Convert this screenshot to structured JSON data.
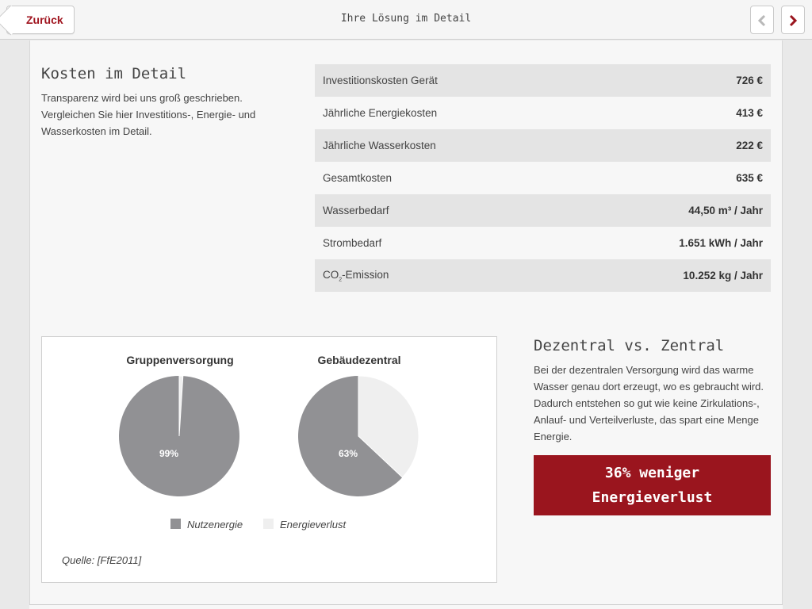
{
  "header": {
    "back_label": "Zurück",
    "title": "Ihre Lösung im Detail"
  },
  "kosten": {
    "title": "Kosten im Detail",
    "text": "Transparenz wird bei uns groß geschrieben. Vergleichen Sie hier Investitions-, Energie- und Wasserkosten im Detail."
  },
  "cost_table": [
    {
      "label": "Investitionskosten Gerät",
      "value": "726 €"
    },
    {
      "label": "Jährliche Energiekosten",
      "value": "413 €"
    },
    {
      "label": "Jährliche Wasserkosten",
      "value": "222 €"
    },
    {
      "label": "Gesamtkosten",
      "value": "635 €"
    },
    {
      "label": "Wasserbedarf",
      "value": "44,50 m³ / Jahr"
    },
    {
      "label": "Strombedarf",
      "value": "1.651 kWh / Jahr"
    },
    {
      "label_prefix": "CO",
      "label_sub": "2",
      "label_suffix": "-Emission",
      "value": "10.252 kg / Jahr"
    }
  ],
  "colors": {
    "accent": "#9a151e",
    "nutzenergie": "#919194",
    "energieverlust": "#efefef"
  },
  "chart_data": {
    "type": "pie",
    "charts": [
      {
        "title": "Gruppenversorgung",
        "label": "99%",
        "slices": [
          {
            "name": "Nutzenergie",
            "value": 99
          },
          {
            "name": "Energieverlust",
            "value": 1
          }
        ]
      },
      {
        "title": "Gebäudezentral",
        "label": "63%",
        "slices": [
          {
            "name": "Nutzenergie",
            "value": 63
          },
          {
            "name": "Energieverlust",
            "value": 37
          }
        ]
      }
    ],
    "legend": [
      "Nutzenergie",
      "Energieverlust"
    ],
    "legend_position": "bottom"
  },
  "source_label": "Quelle: [FfE2011]",
  "dezentral": {
    "title": "Dezentral vs. Zentral",
    "text": "Bei der dezentralen Versorgung wird das warme Wasser genau dort erzeugt, wo es gebraucht wird. Dadurch entstehen so gut wie keine Zirkulations-, Anlauf- und Verteilverluste, das spart eine Menge Energie.",
    "banner_line1": "36% weniger",
    "banner_line2": "Energieverlust"
  }
}
